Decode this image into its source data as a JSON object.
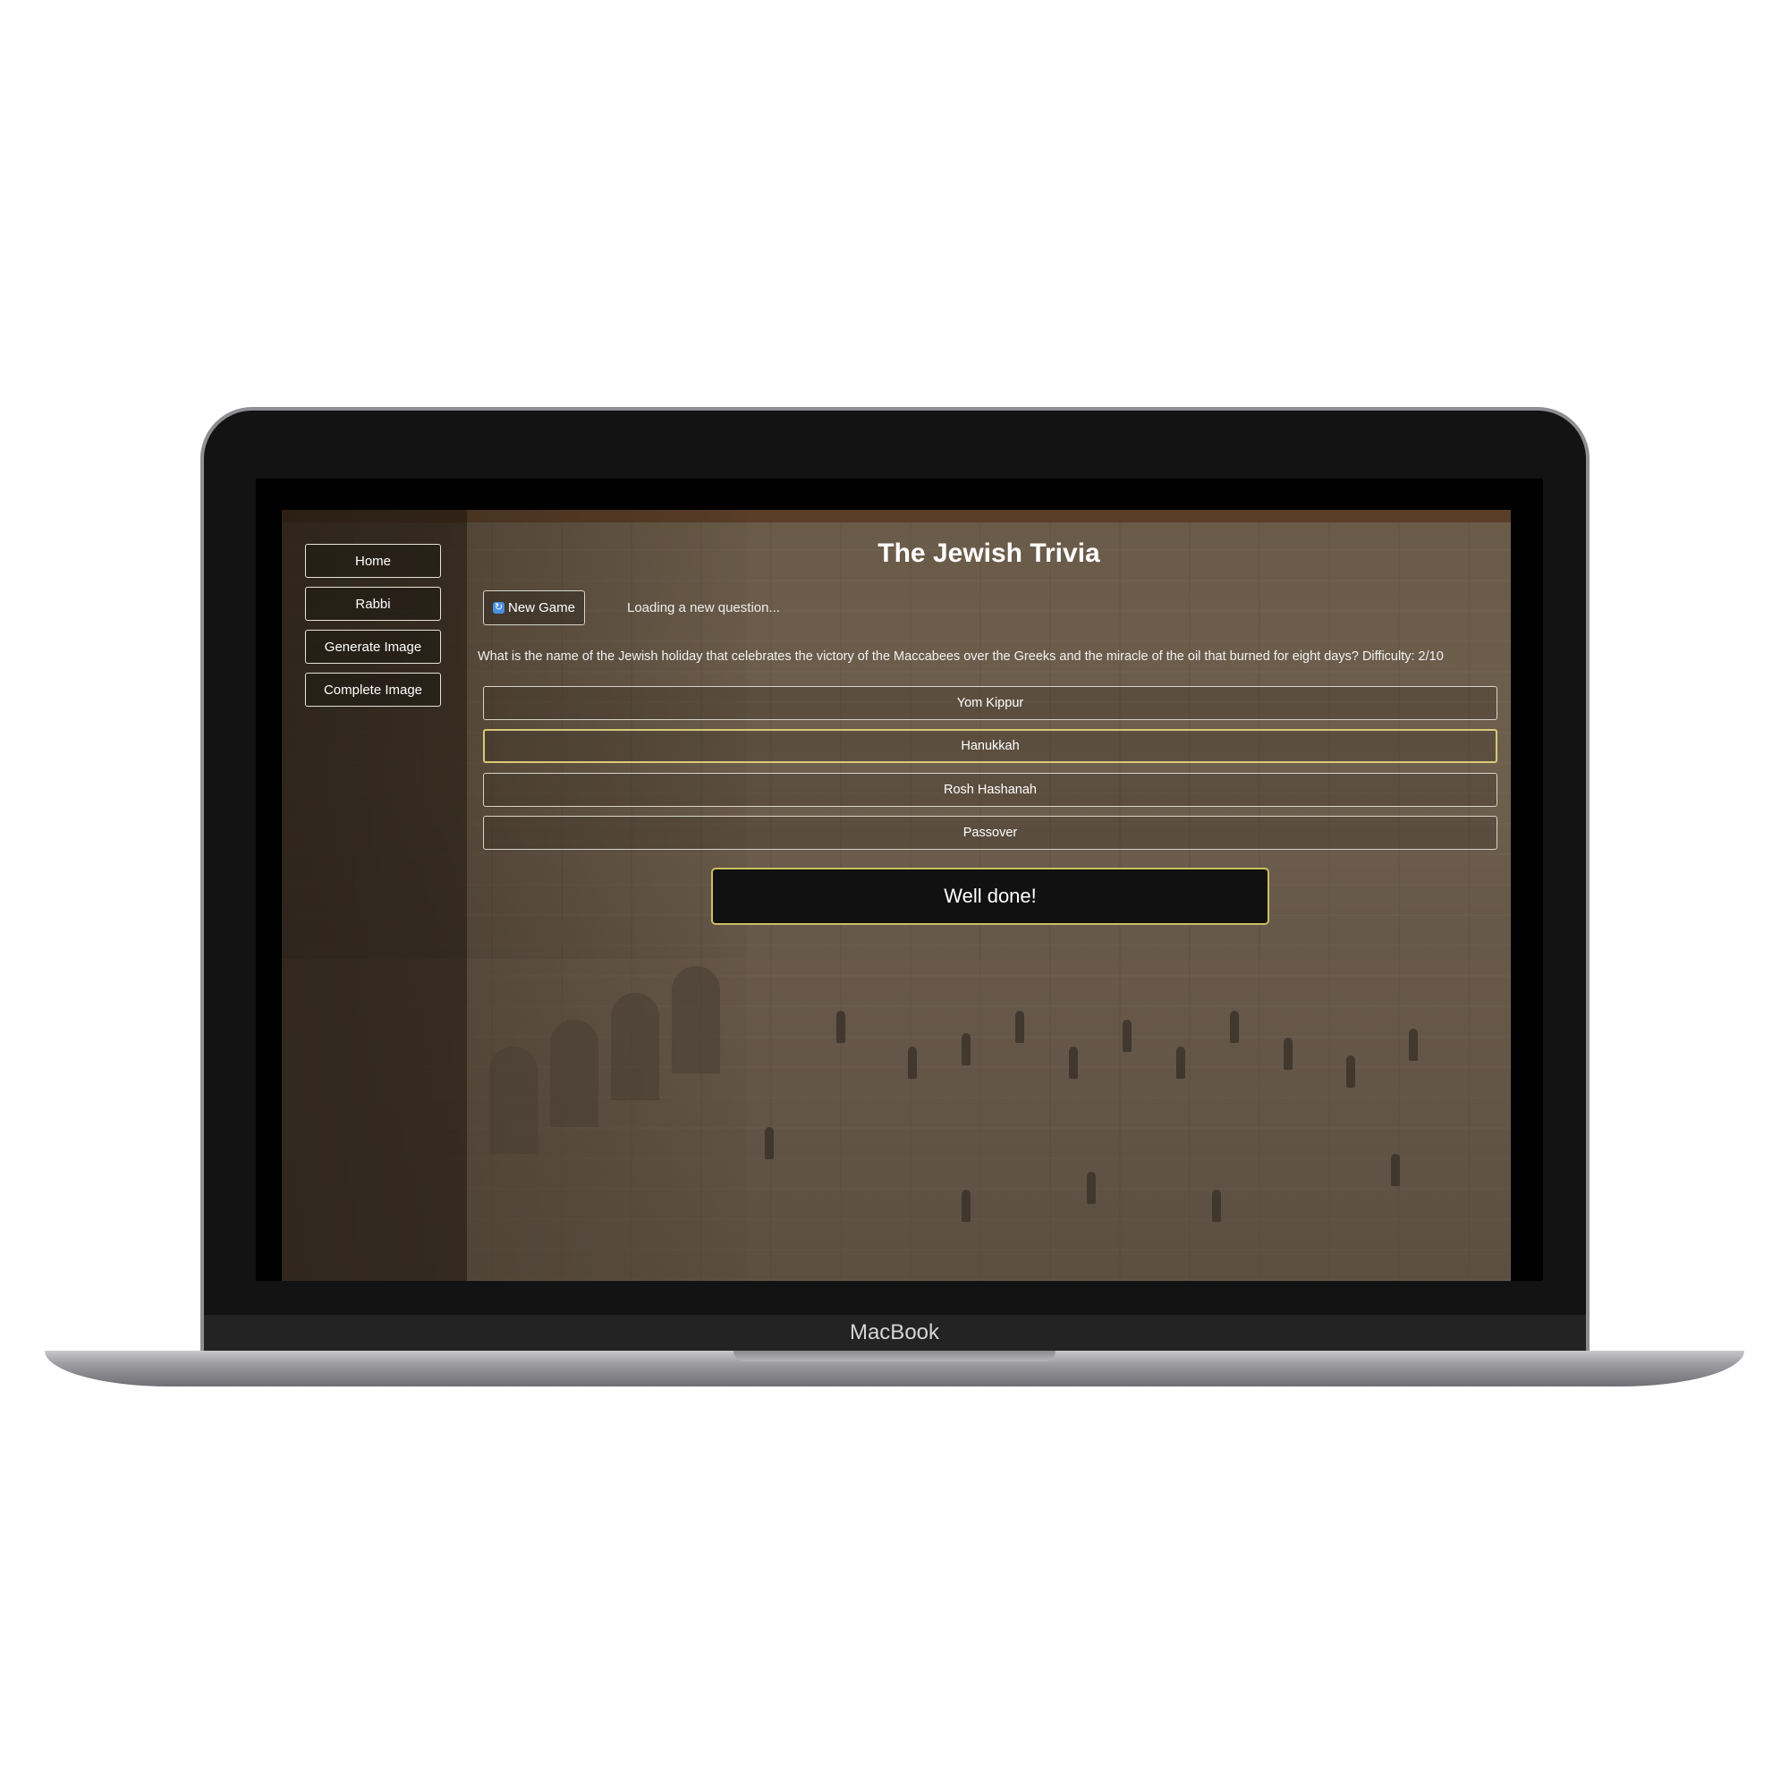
{
  "device": {
    "brand_label": "MacBook"
  },
  "sidebar": {
    "items": [
      {
        "label": "Home"
      },
      {
        "label": "Rabbi"
      },
      {
        "label": "Generate Image"
      },
      {
        "label": "Complete Image"
      }
    ]
  },
  "main": {
    "title": "The Jewish Trivia",
    "new_game_label": "New Game",
    "new_game_icon": "refresh-icon",
    "status_text": "Loading a new question...",
    "question": "What is the name of the Jewish holiday that celebrates the victory of the Maccabees over the Greeks and the miracle of the oil that burned for eight days? Difficulty: 2/10",
    "answers": [
      {
        "label": "Yom Kippur",
        "selected": false
      },
      {
        "label": "Hanukkah",
        "selected": true
      },
      {
        "label": "Rosh Hashanah",
        "selected": false
      },
      {
        "label": "Passover",
        "selected": false
      }
    ],
    "feedback": "Well done!"
  },
  "colors": {
    "selected_border": "#d8c978",
    "feedback_border": "#cdbf60",
    "text": "#ffffff"
  }
}
